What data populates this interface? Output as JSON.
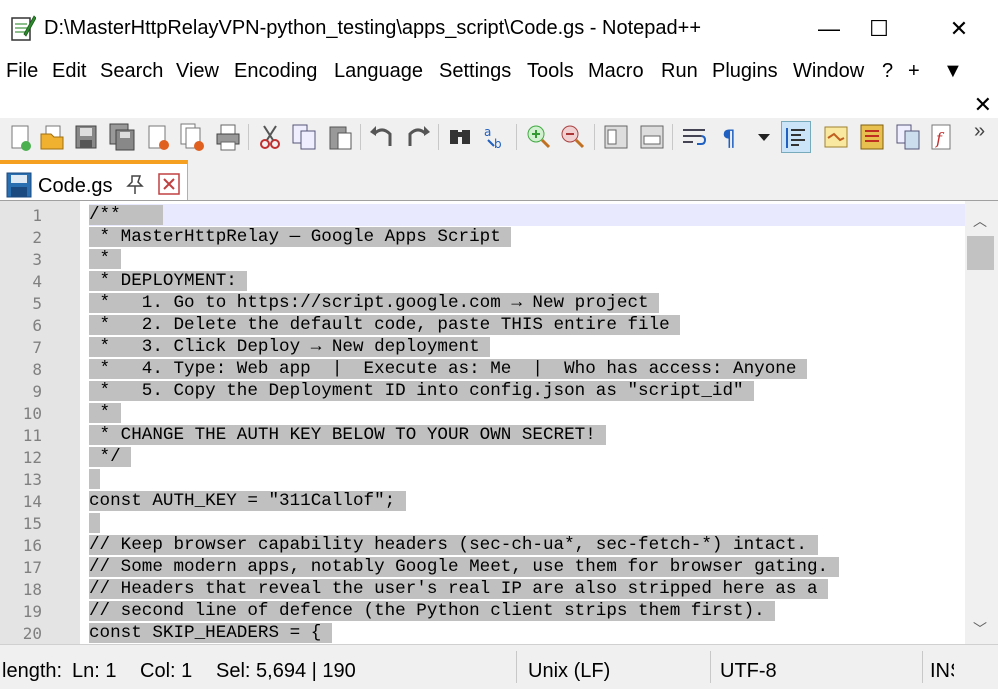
{
  "window": {
    "title": "D:\\MasterHttpRelayVPN-python_testing\\apps_script\\Code.gs - Notepad++",
    "minimize_glyph": "—",
    "maximize_glyph": "☐",
    "close_glyph": "✕"
  },
  "menu": {
    "items": [
      "File",
      "Edit",
      "Search",
      "View",
      "Encoding",
      "Language",
      "Settings",
      "Tools",
      "Macro",
      "Run",
      "Plugins",
      "Window",
      "?",
      "+",
      "▼"
    ],
    "doc_close_glyph": "✕"
  },
  "toolbar": {
    "icons": [
      "new-file-icon",
      "open-file-icon",
      "save-icon",
      "save-all-icon",
      "close-icon",
      "close-all-icon",
      "print-icon",
      "cut-icon",
      "copy-icon",
      "paste-icon",
      "undo-icon",
      "redo-icon",
      "find-icon",
      "replace-icon",
      "zoom-in-icon",
      "zoom-out-icon",
      "sync-vertical-icon",
      "sync-horizontal-icon",
      "word-wrap-icon",
      "show-all-chars-icon",
      "indent-guide-icon",
      "doc-map-icon",
      "function-list-icon",
      "folder-workspace-icon",
      "doc-list-icon",
      "monitoring-icon"
    ],
    "overflow_glyph": "»"
  },
  "tab": {
    "label": "Code.gs",
    "pin_glyph": "📌",
    "close_glyph": "✕"
  },
  "editor": {
    "lines": [
      "/**",
      " * MasterHttpRelay — Google Apps Script",
      " *",
      " * DEPLOYMENT:",
      " *   1. Go to https://script.google.com → New project",
      " *   2. Delete the default code, paste THIS entire file",
      " *   3. Click Deploy → New deployment",
      " *   4. Type: Web app  |  Execute as: Me  |  Who has access: Anyone",
      " *   5. Copy the Deployment ID into config.json as \"script_id\"",
      " *",
      " * CHANGE THE AUTH KEY BELOW TO YOUR OWN SECRET!",
      " */",
      "",
      "const AUTH_KEY = \"311Callof\";",
      "",
      "// Keep browser capability headers (sec-ch-ua*, sec-fetch-*) intact.",
      "// Some modern apps, notably Google Meet, use them for browser gating.",
      "// Headers that reveal the user's real IP are also stripped here as a",
      "// second line of defence (the Python client strips them first).",
      "const SKIP_HEADERS = {"
    ]
  },
  "status": {
    "length": "length:",
    "ln": "Ln: 1",
    "col": "Col: 1",
    "sel": "Sel: 5,694 | 190",
    "eol": "Unix (LF)",
    "encoding": "UTF-8",
    "mode": "INS"
  },
  "colors": {
    "tab_accent": "#f5a020",
    "selection": "#c0c0c0",
    "current_line": "#e8e8ff",
    "gutter": "#e4e4e4"
  }
}
